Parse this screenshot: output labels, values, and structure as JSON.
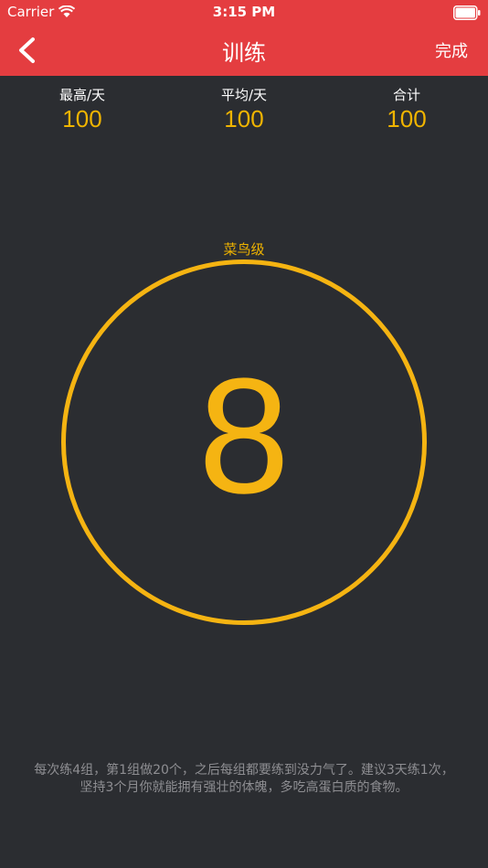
{
  "status_bar": {
    "carrier": "Carrier",
    "time": "3:15 PM"
  },
  "nav": {
    "title": "训练",
    "done_label": "完成"
  },
  "stats": [
    {
      "label": "最高/天",
      "value": "100"
    },
    {
      "label": "平均/天",
      "value": "100"
    },
    {
      "label": "合计",
      "value": "100"
    }
  ],
  "level": "菜鸟级",
  "counter": "8",
  "tips": [
    "每次练4组，第1组做20个，之后每组都要练到没力气了。建议3天练1次，",
    "坚持3个月你就能拥有强壮的体魄，多吃高蛋白质的食物。"
  ],
  "colors": {
    "accent": "#f5b412",
    "nav": "#e43d40",
    "background": "#2b2d31"
  }
}
